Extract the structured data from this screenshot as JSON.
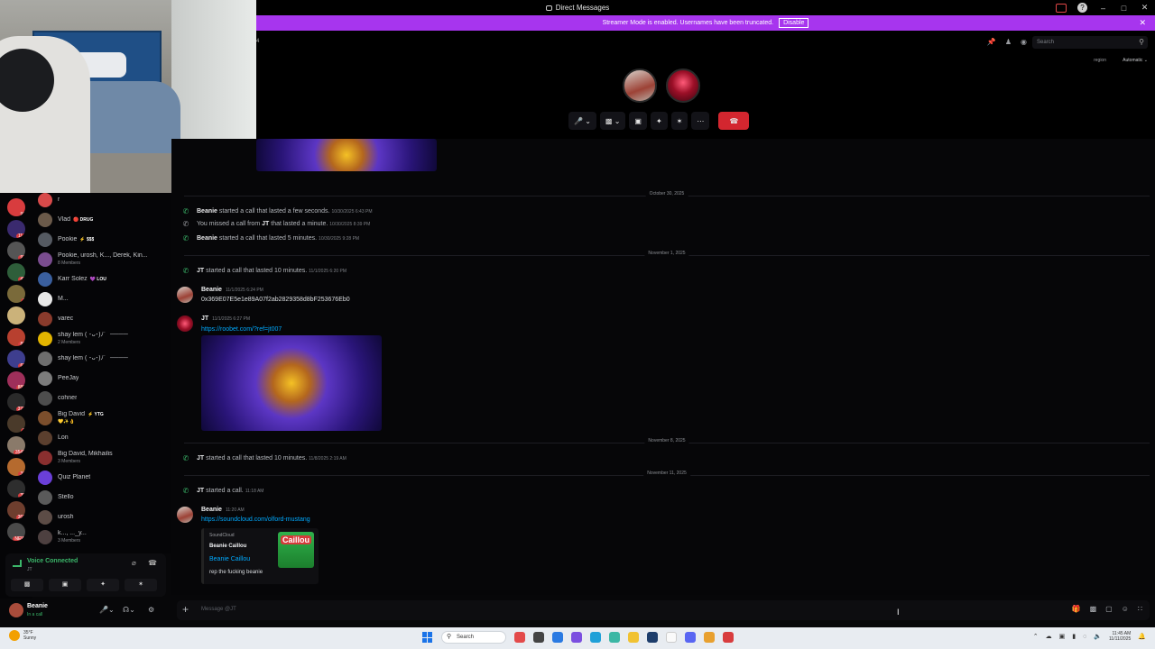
{
  "window": {
    "title": "Direct Messages"
  },
  "banner": {
    "text": "Streamer Mode is enabled. Usernames have been truncated.",
    "disable_label": "Disable"
  },
  "call": {
    "header_fragment": "4",
    "search_placeholder": "Search",
    "region_label": "region",
    "region_value": "Automatic"
  },
  "dm_list": [
    {
      "name": "r",
      "tag": "",
      "sub": "",
      "color": "#d84a4a"
    },
    {
      "name": "Vlad",
      "tag": "🔴 DRUG",
      "sub": "",
      "color": "#6b5a4a"
    },
    {
      "name": "Pookie",
      "tag": "⚡ $$$",
      "sub": "",
      "color": "#555a62"
    },
    {
      "name": "Pookie, urosh, K..., Derek, Kin...",
      "tag": "",
      "sub": "8 Members",
      "color": "#7a4c8f"
    },
    {
      "name": "Karr Solez",
      "tag": "💜 LOU",
      "sub": "",
      "color": "#3a5f9e"
    },
    {
      "name": "M...",
      "tag": "",
      "sub": "",
      "color": "#e8e8e8"
    },
    {
      "name": "varec",
      "tag": "",
      "sub": "",
      "color": "#8a3b2c"
    },
    {
      "name": "shay lem ( ･ᴗ･)ﾉ゛────",
      "tag": "",
      "sub": "2 Members",
      "color": "#e2b400"
    },
    {
      "name": "shay lem ( ･ᴗ･)ﾉ゛────",
      "tag": "",
      "sub": "",
      "color": "#6e6e6e"
    },
    {
      "name": "PeeJay",
      "tag": "",
      "sub": "",
      "color": "#7c7c7c"
    },
    {
      "name": "cohner",
      "tag": "",
      "sub": "",
      "color": "#4d4d4d"
    },
    {
      "name": "Big David",
      "tag": "⚡ YTG",
      "sub": "💛✨👌",
      "color": "#7b4e2c"
    },
    {
      "name": "Lon",
      "tag": "",
      "sub": "",
      "color": "#5b3f2e"
    },
    {
      "name": "Big David, Mikhailis",
      "tag": "",
      "sub": "3 Members",
      "color": "#8a2f2f"
    },
    {
      "name": "Quiz Planet",
      "tag": "",
      "sub": "",
      "color": "#6a3fd8"
    },
    {
      "name": "Stello",
      "tag": "",
      "sub": "",
      "color": "#5a5a5a"
    },
    {
      "name": "urosh",
      "tag": "",
      "sub": "",
      "color": "#5c4c46"
    },
    {
      "name": "k..., ..._y...",
      "tag": "",
      "sub": "3 Members",
      "color": "#4d4040"
    }
  ],
  "servers": [
    {
      "badge": "90",
      "color": "#d83c3e"
    },
    {
      "badge": "114",
      "color": "#3a2a6e"
    },
    {
      "badge": "93",
      "color": "#555"
    },
    {
      "badge": "43",
      "color": "#2e5e3a"
    },
    {
      "badge": "1",
      "color": "#7a6a3a"
    },
    {
      "badge": "",
      "color": "#cbb27a"
    },
    {
      "badge": "86",
      "color": "#b8402f"
    },
    {
      "badge": "63",
      "color": "#3e3e8e"
    },
    {
      "badge": "889",
      "color": "#9e2f5a"
    },
    {
      "badge": "377",
      "color": "#2a2a2a"
    },
    {
      "badge": "2",
      "color": "#4a3a2a"
    },
    {
      "badge": "3545",
      "color": "#8a7a6a"
    },
    {
      "badge": "36",
      "color": "#b56a2e"
    },
    {
      "badge": "35",
      "color": "#2e2e2e"
    },
    {
      "badge": "362",
      "color": "#6e3e2e"
    },
    {
      "badge": "NEW",
      "color": "#4a4a4a"
    }
  ],
  "voice": {
    "status": "Voice Connected",
    "sub": "JT"
  },
  "user": {
    "name": "Beanie",
    "status": "In a call"
  },
  "messages": {
    "dates": [
      "October 30, 2025",
      "November 1, 2025",
      "November 8, 2025",
      "November 11, 2025"
    ],
    "oct30": [
      {
        "who": "Beanie",
        "text": "started a call that lasted a few seconds.",
        "ts": "10/30/2025 6:43 PM"
      },
      {
        "pre": "You missed a call from",
        "who": "JT",
        "text": "that lasted a minute.",
        "ts": "10/30/2025 8:39 PM"
      },
      {
        "who": "Beanie",
        "text": "started a call that lasted 5 minutes.",
        "ts": "10/30/2025 9:28 PM"
      }
    ],
    "nov1_call": {
      "who": "JT",
      "text": "started a call that lasted 10 minutes.",
      "ts": "11/1/2025 6:20 PM"
    },
    "beanie_msg": {
      "author": "Beanie",
      "ts": "11/1/2025 6:24 PM",
      "text": "0x369E07E5e1e89A07f2ab2829358d8bF253676Eb0"
    },
    "jt_msg": {
      "author": "JT",
      "ts": "11/1/2025 6:27 PM",
      "link": "https://roobet.com/?ref=jt007"
    },
    "nov8_call": {
      "who": "JT",
      "text": "started a call that lasted 10 minutes.",
      "ts": "11/8/2025 2:19 AM"
    },
    "nov11_call": {
      "who": "JT",
      "text": "started a call.",
      "ts": "11:18 AM"
    },
    "beanie_msg2": {
      "author": "Beanie",
      "ts": "11:20 AM",
      "link": "https://soundcloud.com/olford-mustang"
    },
    "embed": {
      "provider": "SoundCloud",
      "author": "Beanie Caillou",
      "title": "Beanie Caillou",
      "desc": "rep the fucking beanie",
      "thumb_text": "Caillou"
    }
  },
  "composer": {
    "placeholder": "Message @JT"
  },
  "taskbar": {
    "weather_temp": "35°F",
    "weather_desc": "Sunny",
    "search_label": "Search",
    "time": "11:45 AM",
    "date": "11/11/2025"
  }
}
